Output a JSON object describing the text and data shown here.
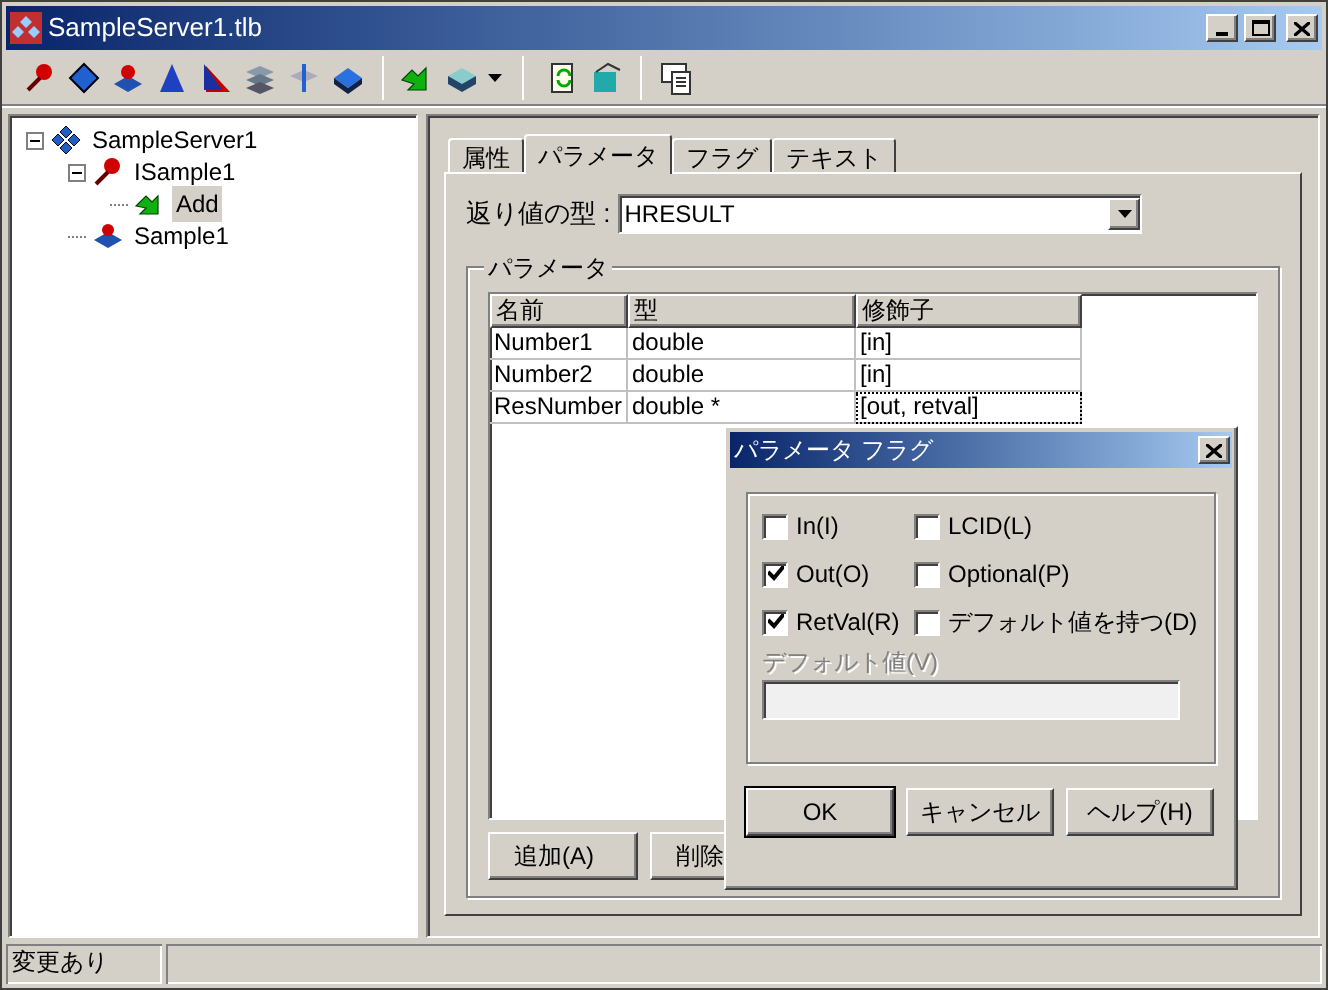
{
  "window": {
    "title": "SampleServer1.tlb"
  },
  "tree": [
    {
      "label": "SampleServer1",
      "kind": "library",
      "expanded": true,
      "selected": false,
      "children": [
        {
          "label": "ISample1",
          "kind": "interface",
          "expanded": true,
          "selected": false,
          "children": [
            {
              "label": "Add",
              "kind": "method",
              "selected": true
            }
          ]
        },
        {
          "label": "Sample1",
          "kind": "coclass",
          "selected": false
        }
      ]
    }
  ],
  "tabs": [
    {
      "label": "属性",
      "selected": false
    },
    {
      "label": "パラメータ",
      "selected": true
    },
    {
      "label": "フラグ",
      "selected": false
    },
    {
      "label": "テキスト",
      "selected": false
    }
  ],
  "return_type": {
    "label": "返り値の型 :",
    "value": "HRESULT"
  },
  "params_group": {
    "title": "パラメータ"
  },
  "table": {
    "columns": [
      "名前",
      "型",
      "修飾子"
    ],
    "rows": [
      {
        "cells": [
          "Number1",
          "double",
          "[in]"
        ],
        "focused": false
      },
      {
        "cells": [
          "Number2",
          "double",
          "[in]"
        ],
        "focused": false
      },
      {
        "cells": [
          "ResNumber",
          "double *",
          "[out, retval]"
        ],
        "focused": true
      }
    ]
  },
  "buttons": [
    "追加(A)",
    "削除"
  ],
  "dialog": {
    "title": "パラメータ フラグ",
    "flags": [
      {
        "label": "In(I)",
        "checked": false
      },
      {
        "label": "LCID(L)",
        "checked": false
      },
      {
        "label": "Out(O)",
        "checked": true
      },
      {
        "label": "Optional(P)",
        "checked": false
      },
      {
        "label": "RetVal(R)",
        "checked": true
      },
      {
        "label": "デフォルト値を持つ(D)",
        "checked": false
      }
    ],
    "default_value": {
      "label": "デフォルト値(V)",
      "disabled": true
    },
    "buttons": [
      {
        "label": "OK",
        "default": true
      },
      {
        "label": "キャンセル",
        "default": false
      },
      {
        "label": "ヘルプ(H)",
        "default": false
      }
    ]
  },
  "status_bar": {
    "text": "変更あり"
  }
}
